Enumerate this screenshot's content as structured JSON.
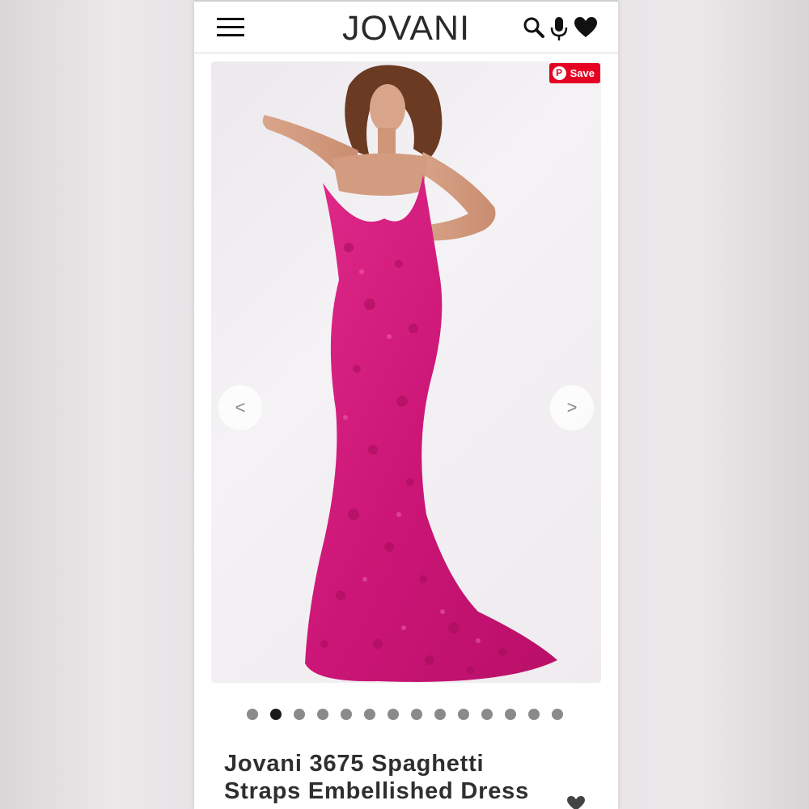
{
  "header": {
    "brand": "JOVANI",
    "icons": [
      "menu-icon",
      "search-icon",
      "mic-icon",
      "heart-icon"
    ]
  },
  "gallery": {
    "save_button_label": "Save",
    "pinterest_glyph": "P",
    "prev_label": "<",
    "next_label": ">",
    "slide_count": 14,
    "active_slide": 2
  },
  "product": {
    "title_line1": "Jovani 3675 Spaghetti",
    "title_line2": "Straps Embellished Dress"
  },
  "colors": {
    "dress": "#d91e7f",
    "pinterest_red": "#e60023",
    "text": "#2f2f2f"
  }
}
